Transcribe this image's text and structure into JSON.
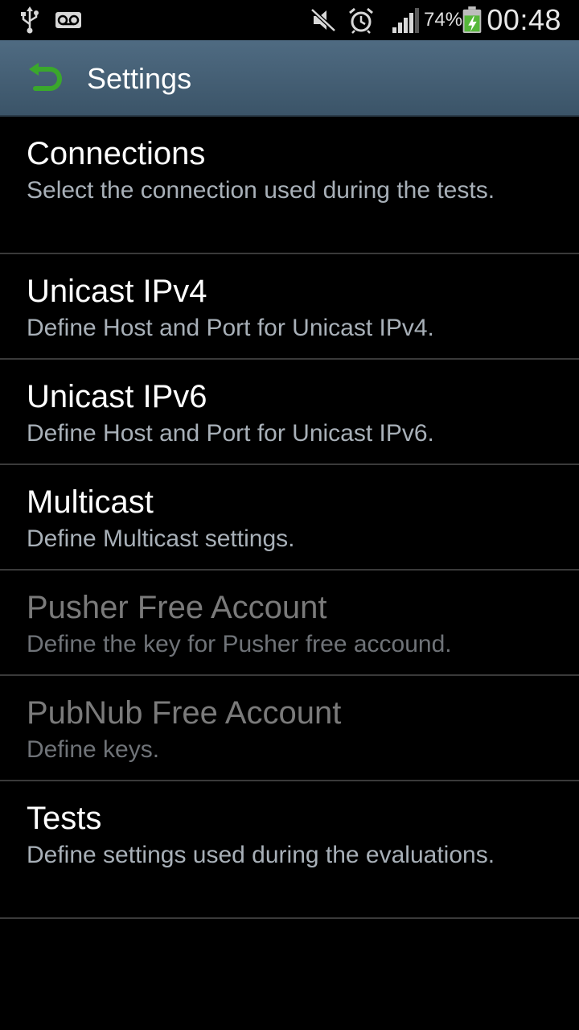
{
  "status_bar": {
    "icons": [
      "usb-icon",
      "voicemail-icon",
      "mute-icon",
      "alarm-icon",
      "signal-icon",
      "battery-charging-icon"
    ],
    "battery_percent": "74%",
    "clock": "00:48"
  },
  "action_bar": {
    "back_icon": "back-arrow-icon",
    "title": "Settings",
    "accent_color": "#3aa82c"
  },
  "preferences": [
    {
      "title": "Connections",
      "summary": "Select the connection used during the tests.",
      "enabled": true
    },
    {
      "title": "Unicast IPv4",
      "summary": "Define Host and Port for Unicast IPv4.",
      "enabled": true
    },
    {
      "title": "Unicast IPv6",
      "summary": "Define Host and Port for Unicast IPv6.",
      "enabled": true
    },
    {
      "title": "Multicast",
      "summary": "Define Multicast settings.",
      "enabled": true
    },
    {
      "title": "Pusher Free Account",
      "summary": "Define the key for Pusher free accound.",
      "enabled": false
    },
    {
      "title": "PubNub Free Account",
      "summary": "Define keys.",
      "enabled": false
    },
    {
      "title": "Tests",
      "summary": "Define settings used during the evaluations.",
      "enabled": true
    }
  ]
}
